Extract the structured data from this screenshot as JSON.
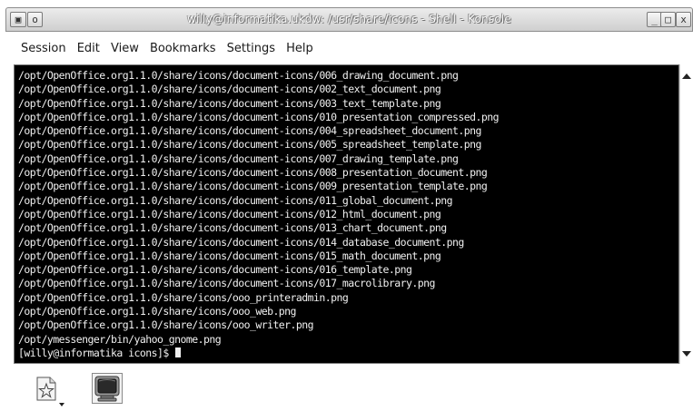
{
  "window": {
    "title": "willy@informatika.ukdw: /usr/share/icons - Shell - Konsole",
    "menu_button_glyph": "▣",
    "sticky_glyph": "o",
    "minimize_glyph": "_",
    "maximize_glyph": "□",
    "close_glyph": "x"
  },
  "menu": {
    "items": [
      "Session",
      "Edit",
      "View",
      "Bookmarks",
      "Settings",
      "Help"
    ]
  },
  "terminal": {
    "lines": [
      "/opt/OpenOffice.org1.1.0/share/icons/document-icons/006_drawing_document.png",
      "/opt/OpenOffice.org1.1.0/share/icons/document-icons/002_text_document.png",
      "/opt/OpenOffice.org1.1.0/share/icons/document-icons/003_text_template.png",
      "/opt/OpenOffice.org1.1.0/share/icons/document-icons/010_presentation_compressed.png",
      "/opt/OpenOffice.org1.1.0/share/icons/document-icons/004_spreadsheet_document.png",
      "/opt/OpenOffice.org1.1.0/share/icons/document-icons/005_spreadsheet_template.png",
      "/opt/OpenOffice.org1.1.0/share/icons/document-icons/007_drawing_template.png",
      "/opt/OpenOffice.org1.1.0/share/icons/document-icons/008_presentation_document.png",
      "/opt/OpenOffice.org1.1.0/share/icons/document-icons/009_presentation_template.png",
      "/opt/OpenOffice.org1.1.0/share/icons/document-icons/011_global_document.png",
      "/opt/OpenOffice.org1.1.0/share/icons/document-icons/012_html_document.png",
      "/opt/OpenOffice.org1.1.0/share/icons/document-icons/013_chart_document.png",
      "/opt/OpenOffice.org1.1.0/share/icons/document-icons/014_database_document.png",
      "/opt/OpenOffice.org1.1.0/share/icons/document-icons/015_math_document.png",
      "/opt/OpenOffice.org1.1.0/share/icons/document-icons/016_template.png",
      "/opt/OpenOffice.org1.1.0/share/icons/document-icons/017_macrolibrary.png",
      "/opt/OpenOffice.org1.1.0/share/icons/ooo_printeradmin.png",
      "/opt/OpenOffice.org1.1.0/share/icons/ooo_web.png",
      "/opt/OpenOffice.org1.1.0/share/icons/ooo_writer.png",
      "/opt/ymessenger/bin/yahoo_gnome.png"
    ],
    "prompt": "[willy@informatika icons]$ "
  },
  "tabbar": {
    "new_session_icon": "new-session-icon",
    "shell_icon": "shell-monitor-icon"
  },
  "colors": {
    "terminal_bg": "#000000",
    "terminal_fg": "#f0f0f0",
    "titlebar_start": "#ececec",
    "titlebar_end": "#cfcfcf"
  }
}
